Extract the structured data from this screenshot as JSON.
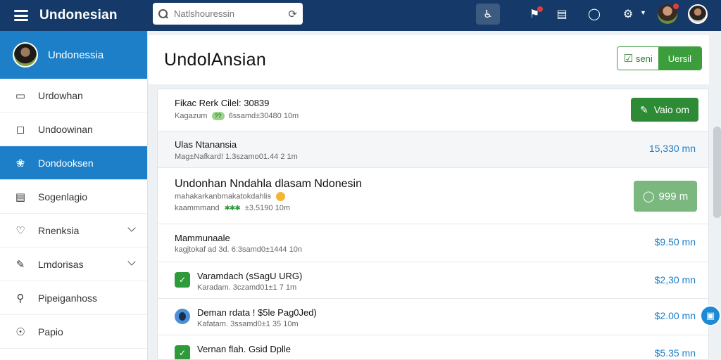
{
  "topbar": {
    "brand": "Undonesian",
    "search_placeholder": "Natlshouressin"
  },
  "sidebar": {
    "user_name": "Undonessia",
    "items": [
      {
        "label": "Urdowhan",
        "icon": "window-icon"
      },
      {
        "label": "Undoowinan",
        "icon": "document-icon"
      },
      {
        "label": "Dondooksen",
        "icon": "group-icon",
        "active": true
      },
      {
        "label": "Sogenlagio",
        "icon": "badge-icon"
      },
      {
        "label": "Rnenksia",
        "icon": "heart-icon",
        "expandable": true
      },
      {
        "label": "Lmdorisas",
        "icon": "pen-icon",
        "expandable": true
      },
      {
        "label": "Pipeiganhoss",
        "icon": "key-icon"
      },
      {
        "label": "Papio",
        "icon": "globe-icon"
      }
    ]
  },
  "header": {
    "title": "UndolAnsian",
    "split_left_label": "seni",
    "split_right_label": "Uersil"
  },
  "rows": [
    {
      "title": "Fikac Rerk Cilel: 30839",
      "pre": "Kagazum",
      "pill": "??",
      "sub": "6ssamd±30480 10m",
      "button": "Vaio om"
    },
    {
      "title": "Ulas Ntanansia",
      "sub": "Mag±Nafkard! 1.3szamo01.44 2 1m",
      "amount": "15,330 mn"
    },
    {
      "title": "Undonhan Nndahla dlasam Ndonesin",
      "sub1": "mahakarkanbmakatokdahlis",
      "pre": "kaammmand",
      "sub2": "±3.5190 10m",
      "button": "999 m"
    },
    {
      "title": "Mammunaale",
      "sub": "kagjtokaf ad  3d. 6:3samd0±1444 10n",
      "amount": "$9.50 mn"
    },
    {
      "title": "Varamdach (sSagU URG)",
      "sub": "Karadam. 3czamd01±1 7 1m",
      "amount": "$2,30 mn"
    },
    {
      "title": "Deman rdata ! $5le Pag0Jed)",
      "sub": "Kafatam. 3ssamd0±1 35 10m",
      "amount": "$2.00 mn"
    },
    {
      "title": "Vernan flah. Gsid Dplle",
      "sub": "",
      "amount": "$5.35 mn"
    }
  ]
}
